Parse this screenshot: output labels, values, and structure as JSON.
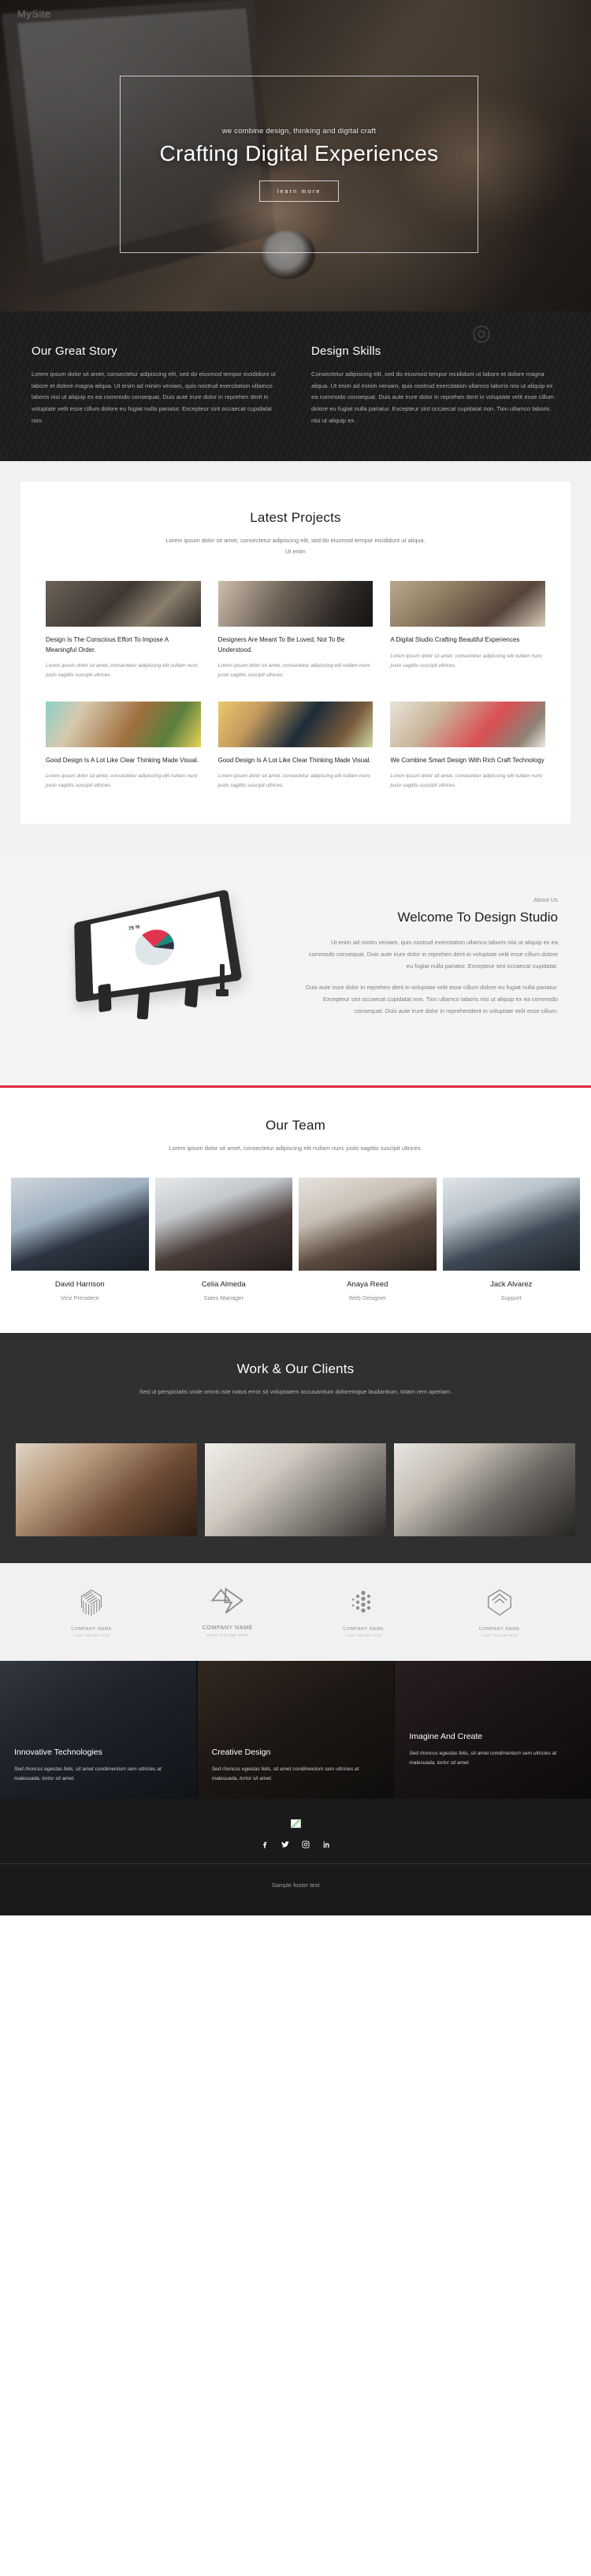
{
  "hero": {
    "logo": "MySite",
    "eyebrow": "we combine design, thinking and digital craft",
    "title": "Crafting Digital Experiences",
    "button": "learn more"
  },
  "story": {
    "columns": [
      {
        "heading": "Our Great Story",
        "body": "Lorem ipsum dolor sit amet, consectetur adipiscing elit, sed do eiusmod tempor incididunt ut labore et dolore magna aliqua. Ut enim ad minim veniam, quis nostrud exercitation ullamco laboris nisi ut aliquip ex ea commodo consequat. Duis aute irure dolor in reprehen derit in voluptate velit esse cillum dolore eu fugiat nulla pariatur. Excepteur sint occaecat cupidatat non."
      },
      {
        "heading": "Design Skills",
        "body": "Consectetur adipiscing elit, sed do eiusmod tempor incididunt ut labore et dolore magna aliqua. Ut enim ad minim veniam, quis nostrud exercitation ullamco laboris nisi ut aliquip ex ea commodo consequat. Duis aute irure dolor in reprehen derit in voluptate velit esse cillum dolore eu fugiat nulla pariatur. Excepteur sint occaecat cupidatat non. Tion ullamco laboris nisi ut aliquip ex."
      }
    ]
  },
  "projects": {
    "title": "Latest Projects",
    "subtitle": "Lorem ipsum dolor sit amet, consectetur adipiscing elit, sed do eiusmod tempor incididunt ut aliqua. Ut enim",
    "items": [
      {
        "title": "Design Is The Conscious Effort To Impose A Meaningful Order.",
        "text": "Lorem ipsum dolor sit amet, consectetur adipiscing elit nullam nunc justo sagittis suscipit ultrices."
      },
      {
        "title": "Designers Are Meant To Be Loved, Not To Be Understood.",
        "text": "Lorem ipsum dolor sit amet, consectetur adipiscing elit nullam nunc justo sagittis suscipit ultrices."
      },
      {
        "title": "A Digital Studio Crafting Beautiful Experiences",
        "text": "Lorem ipsum dolor sit amet, consectetur adipiscing elit nullam nunc justo sagittis suscipit ultrices."
      },
      {
        "title": "Good Design Is A Lot Like Clear Thinking Made Visual.",
        "text": "Lorem ipsum dolor sit amet, consectetur adipiscing elit nullam nunc justo sagittis suscipit ultrices."
      },
      {
        "title": "Good Design Is A Lot Like Clear Thinking Made Visual.",
        "text": "Lorem ipsum dolor sit amet, consectetur adipiscing elit nullam nunc justo sagittis suscipit ultrices."
      },
      {
        "title": "We Combine Smart Design With Rich Craft Technology",
        "text": "Lorem ipsum dolor sit amet, consectetur adipiscing elit nullam nunc justo sagittis suscipit ultrices."
      }
    ]
  },
  "about": {
    "eyebrow": "About Us",
    "title": "Welcome To Design Studio",
    "paragraph1": "Ut enim ad minim veniam, quis nostrud exercitation ullamco laboris nisi ut aliquip ex ea commodo consequat. Duis aute irure dolor in reprehen derit in voluptate velit esse cillum dolore eu fugiat nulla pariatur. Excepteur sint occaecat cupidatat.",
    "paragraph2": "Duis aute irure dolor in reprehen derit in voluptate velit esse cillum dolore eu fugiat nulla pariatur. Excepteur sint occaecat cupidatat non. Tion ullamco laboris nisi ut aliquip ex ea commodo consequat. Duis aute irure dolor in reprehenderit in voluptate velit esse cillum.",
    "tablet_chart": {
      "label": "75 %",
      "slices": [
        50,
        15,
        10,
        25
      ]
    },
    "accent_color": "#e2283c"
  },
  "team": {
    "title": "Our Team",
    "subtitle": "Lorem ipsum dolor sit amet, consectetur adipiscing elit nullam nunc justo sagittis suscipit ultrices.",
    "members": [
      {
        "name": "David Harrison",
        "role": "Vice President"
      },
      {
        "name": "Celia Almeda",
        "role": "Sales Manager"
      },
      {
        "name": "Anaya Reed",
        "role": "Web Designer"
      },
      {
        "name": "Jack Alvarez",
        "role": "Support"
      }
    ]
  },
  "clients": {
    "title": "Work & Our Clients",
    "subtitle": "Sed ut perspiciatis unde omnis iste natus error sit voluptatem accusantium doloremque laudantium, totam rem aperiam.",
    "logos": [
      {
        "name": "COMPANY NAME",
        "tagline": "YOUR TAGLINE HERE",
        "icon": "hatched-cube-icon"
      },
      {
        "name": "COMPANY NAME",
        "tagline": "YOUR TAGLINE HERE",
        "icon": "double-chevron-icon"
      },
      {
        "name": "COMPANY NAME",
        "tagline": "YOUR TAGLINE HERE",
        "icon": "dot-hexagon-icon"
      },
      {
        "name": "COMPANY NAME",
        "tagline": "YOUR TAGLINE HERE",
        "icon": "shield-outline-icon"
      }
    ]
  },
  "features": [
    {
      "title": "Innovative Technologies",
      "text": "Sed rhoncus egestas felis, sit amet condimentum sem ultricies at malesuada, tortor sit amet."
    },
    {
      "title": "Creative Design",
      "text": "Sed rhoncus egestas felis, sit amet condimentum sem ultricies at malesuada, tortor sit amet."
    },
    {
      "title": "Imagine And Create",
      "text": "Sed rhoncus egestas felis, sit amet condimentum sem ultricies at malesuada, tortor sit amet."
    }
  ],
  "footer": {
    "socials": [
      "facebook-icon",
      "twitter-icon",
      "instagram-icon",
      "linkedin-icon"
    ],
    "text": "Sample footer text"
  }
}
